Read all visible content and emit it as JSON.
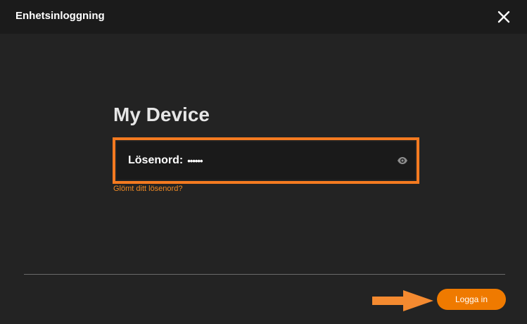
{
  "window": {
    "title": "Enhetsinloggning",
    "close_icon": "close-icon"
  },
  "main": {
    "device_name": "My Device",
    "password": {
      "label": "Lösenord:",
      "value": "••••••",
      "toggle_icon": "eye-icon"
    },
    "forgot_link": "Glömt ditt lösenord?"
  },
  "footer": {
    "login_label": "Logga in"
  },
  "colors": {
    "accent": "#ef7a00",
    "highlight": "#f47a20",
    "background": "#232323",
    "titlebar": "#1b1b1b",
    "field_bg": "#1a1a1a"
  }
}
